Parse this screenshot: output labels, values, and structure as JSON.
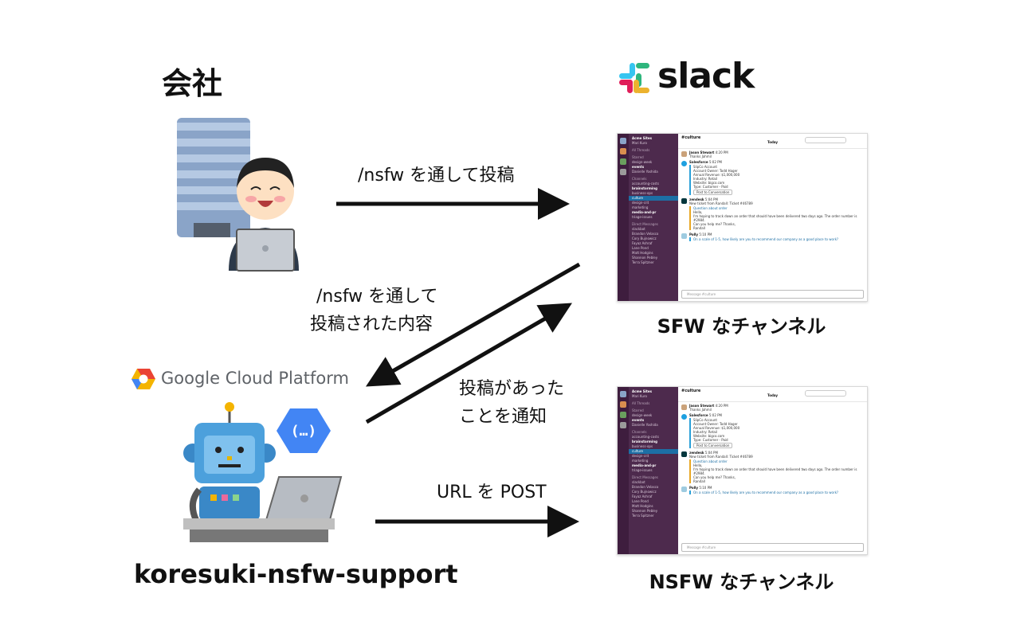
{
  "left": {
    "company_label": "会社",
    "gcp_text": "Google Cloud Platform",
    "bot_name": "koresuki-nsfw-support"
  },
  "slack": {
    "logo_text": "slack"
  },
  "arrows": {
    "post_via_nsfw": "/nsfw を通して投稿",
    "posted_content_line1": "/nsfw を通して",
    "posted_content_line2": "投稿された内容",
    "notify_line1": "投稿があった",
    "notify_line2": "ことを通知",
    "url_post": "URL を POST"
  },
  "captions": {
    "sfw_channel": "SFW なチャンネル",
    "nsfw_channel": "NSFW なチャンネル"
  },
  "slack_window": {
    "workspace": "Acme Sites",
    "user": "Mari Kuro",
    "all_threads": "All Threads",
    "starred_label": "Starred",
    "starred": [
      "design-week",
      "events",
      "Danielle Yoshida"
    ],
    "channels_label": "Channels",
    "channels": [
      "accounting-costs",
      "brainstorming",
      "business-ops",
      "culture",
      "design-crit",
      "marketing",
      "media-and-pr",
      "triage-issues"
    ],
    "dm_label": "Direct Messages",
    "dms": [
      "slackbot",
      "Brandon Velasco",
      "Cory Bujnowicz",
      "Fayaz Ashraf",
      "Lane Pond",
      "Matt Hodgins",
      "Shannon Pebley",
      "Terra Spitzner"
    ],
    "channel_title": "#culture",
    "today": "Today",
    "search": "Search",
    "compose_placeholder": "Message #culture",
    "messages": [
      {
        "author": "Jason Stewart",
        "time": "4:20 PM",
        "text": "Thanks Jahmil"
      },
      {
        "author": "Salesforce",
        "time": "5:02 PM",
        "text": "SlipCo Account"
      },
      {
        "author": "",
        "time": "",
        "text": "Account Owner: Todd Hager"
      },
      {
        "author": "",
        "time": "",
        "text": "Annual Revenue: $1,000,000"
      },
      {
        "author": "",
        "time": "",
        "text": "Industry: Retail"
      },
      {
        "author": "",
        "time": "",
        "text": "Website: bigco.com"
      },
      {
        "author": "",
        "time": "",
        "text": "Type: Customer - Paid"
      },
      {
        "author": "zendesk",
        "time": "5:04 PM",
        "text": "New ticket from Randall: Ticket #46789"
      },
      {
        "author": "",
        "time": "",
        "text": "Question about order"
      },
      {
        "author": "",
        "time": "",
        "text": "Hello,"
      },
      {
        "author": "",
        "time": "",
        "text": "I'm hoping to track down an order that should have been delivered two days ago. The order number is #2984."
      },
      {
        "author": "",
        "time": "",
        "text": "Can you help me? Thanks,"
      },
      {
        "author": "",
        "time": "",
        "text": "Randall"
      },
      {
        "author": "Polly",
        "time": "5:10 PM",
        "text": "On a scale of 1-5, how likely are you to recommend our company as a good place to work?"
      }
    ],
    "post_button": "Post to Conversation"
  }
}
